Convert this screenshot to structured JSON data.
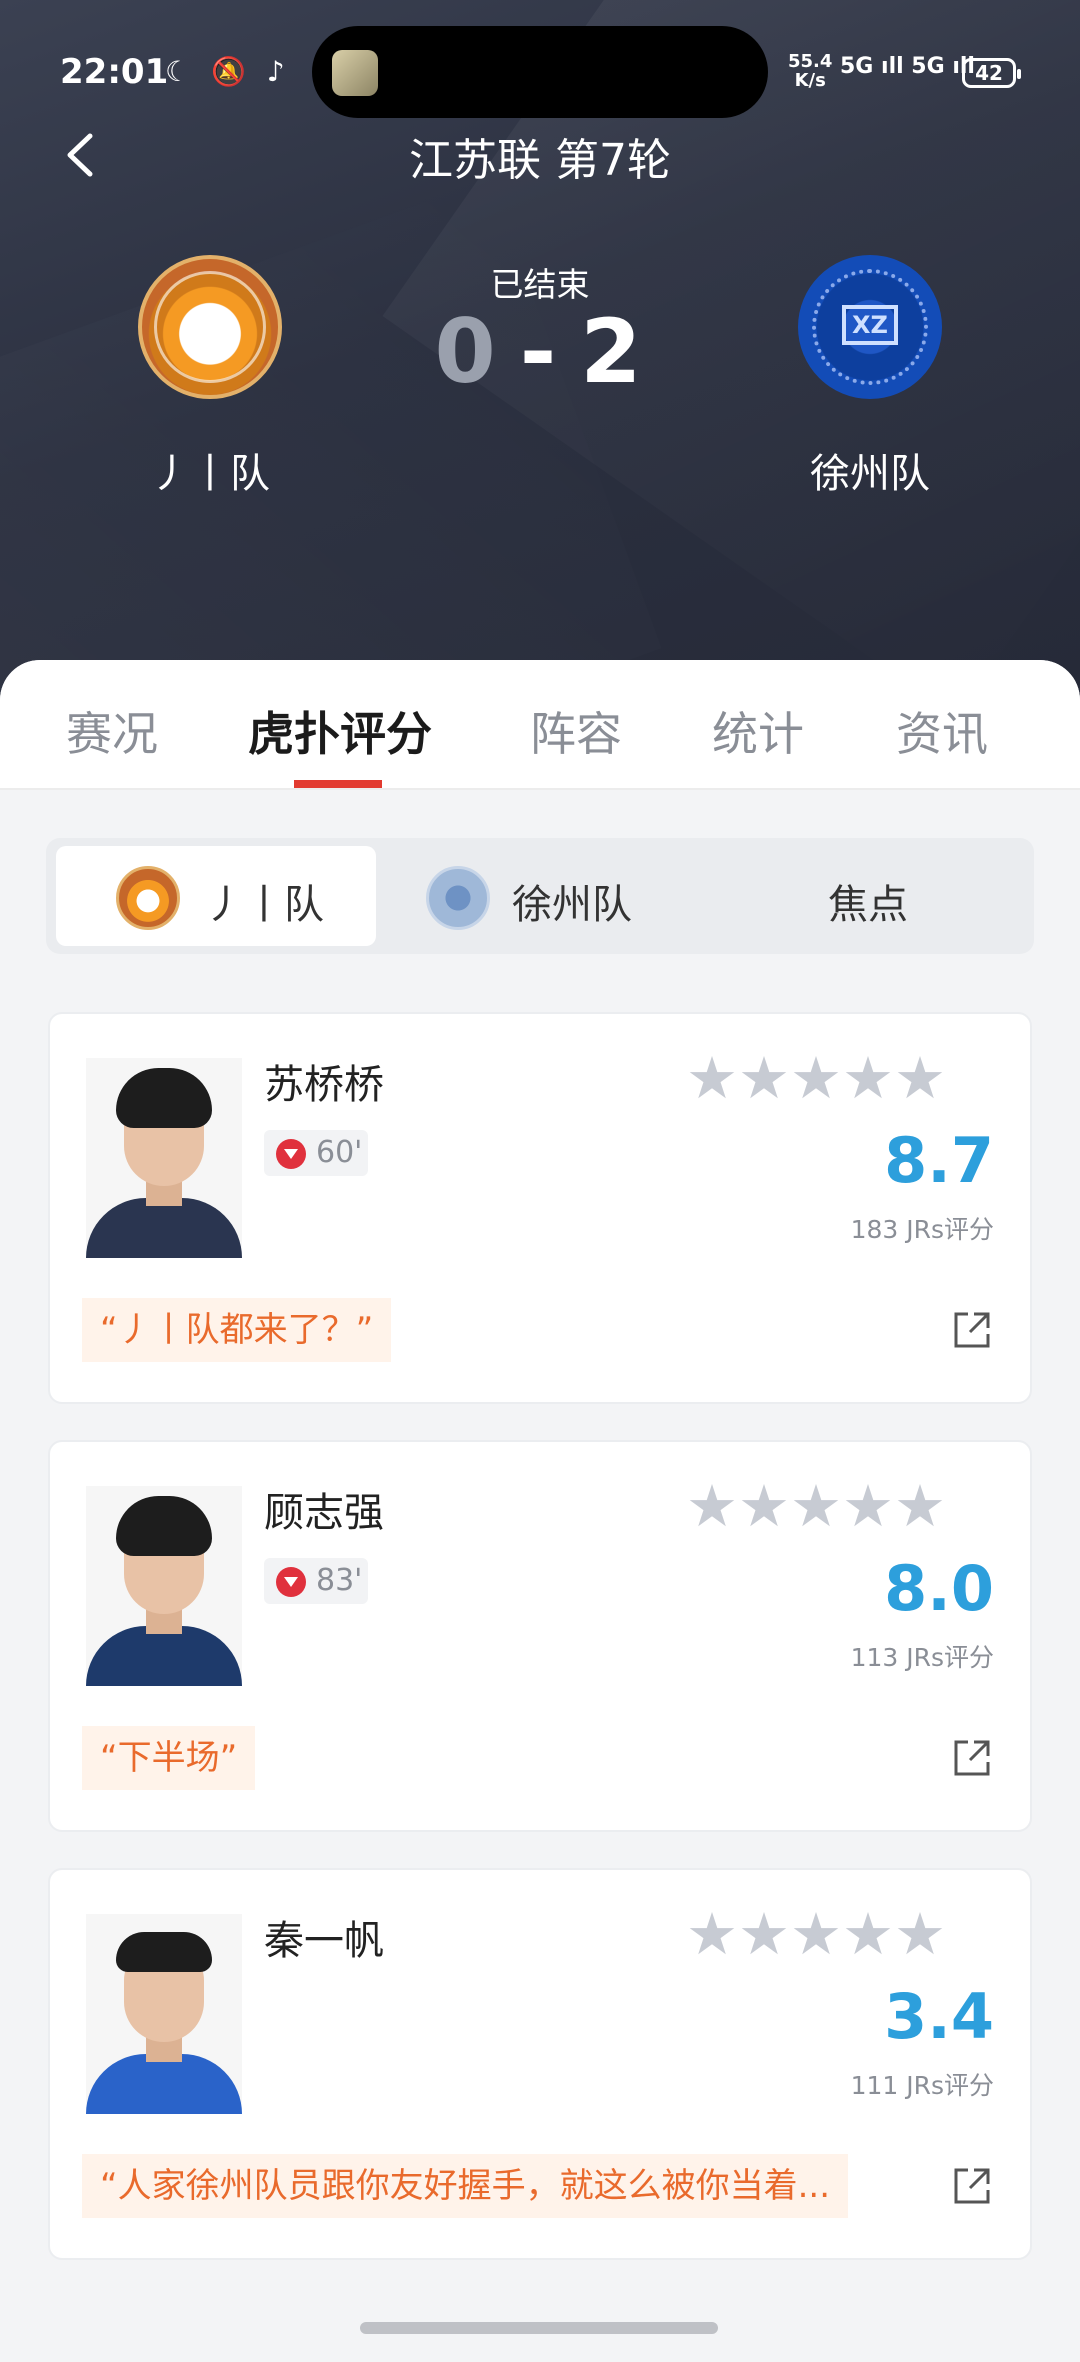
{
  "status_bar": {
    "time": "22:01",
    "icons": "☾ 🔕 ♪",
    "net_speed_top": "55.4",
    "net_speed_bottom": "K/s",
    "signal": "5G ıll 5G ıll",
    "battery": "42"
  },
  "header": {
    "title": "江苏联 第7轮",
    "match_status": "已结束",
    "home_team": "丿丨队",
    "away_team": "徐州队",
    "home_score": "0",
    "score_sep": "-",
    "away_score": "2",
    "away_logo_mark": "XZ"
  },
  "tabs": [
    {
      "label": "赛况"
    },
    {
      "label": "虎扑评分"
    },
    {
      "label": "阵容"
    },
    {
      "label": "统计"
    },
    {
      "label": "资讯"
    }
  ],
  "segments": [
    {
      "label": "丿丨队"
    },
    {
      "label": "徐州队"
    },
    {
      "label": "焦点"
    }
  ],
  "players": [
    {
      "name": "苏桥桥",
      "minute": "60'",
      "stars": "★★★★★",
      "rating": "8.7",
      "votes": "183 JRs评分",
      "quote": "“丿丨队都来了？”",
      "shirt_color": "#2a3550"
    },
    {
      "name": "顾志强",
      "minute": "83'",
      "stars": "★★★★★",
      "rating": "8.0",
      "votes": "113 JRs评分",
      "quote": "“下半场”",
      "shirt_color": "#1e3a6b"
    },
    {
      "name": "秦一帆",
      "minute": "",
      "stars": "★★★★★",
      "rating": "3.4",
      "votes": "111 JRs评分",
      "quote": "“人家徐州队员跟你友好握手，就这么被你当着...",
      "shirt_color": "#2a63c9"
    }
  ],
  "colors": {
    "accent": "#e23a2f",
    "rating": "#2d9fdc",
    "quote_text": "#e96a2c",
    "star": "#c7cbd3"
  }
}
